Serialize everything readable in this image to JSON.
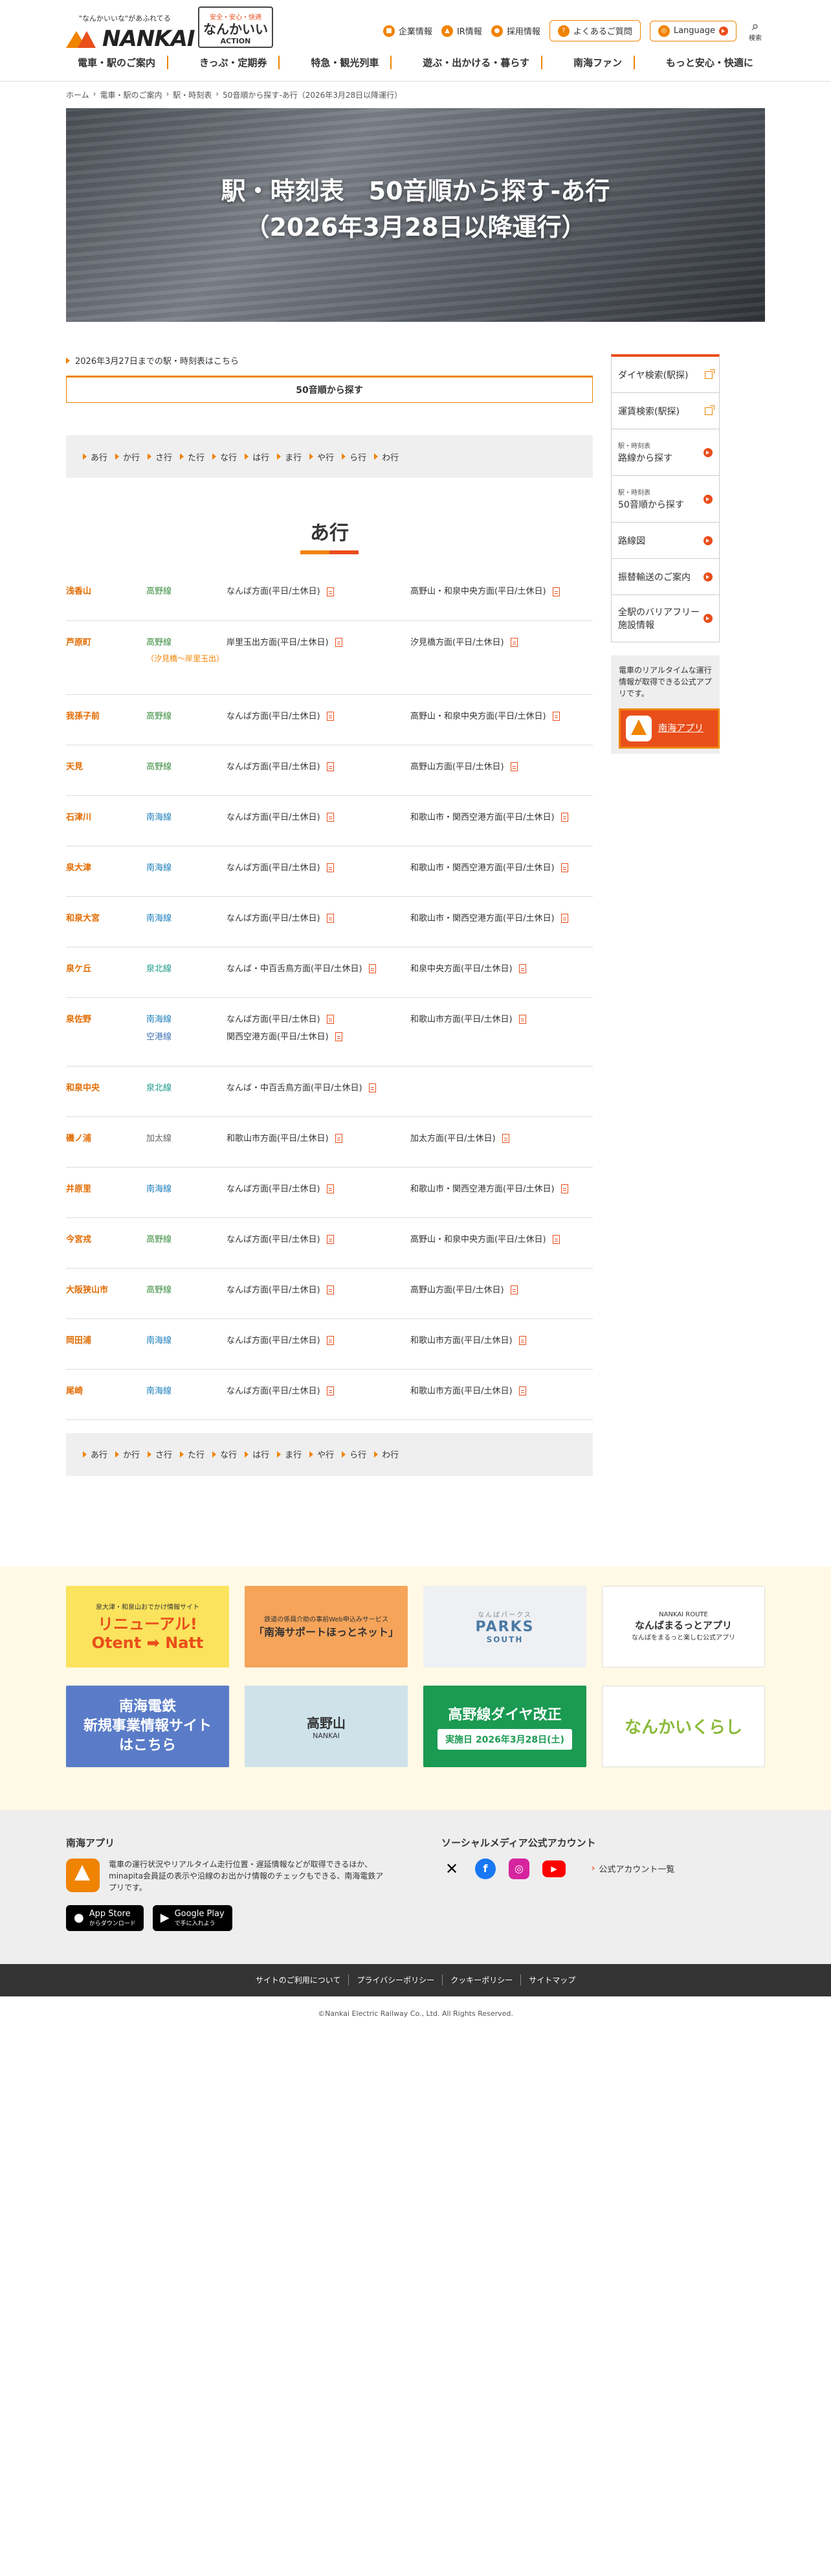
{
  "header": {
    "logo_tagline": "\"なんかいいな\"があふれてる",
    "logo_text": "NANKAI",
    "action_top": "安全・安心・快適",
    "action_main": "なんかいい",
    "action_sub": "ACTION",
    "util": [
      {
        "label": "企業情報",
        "icon": "building-icon"
      },
      {
        "label": "IR情報",
        "icon": "chart-icon"
      },
      {
        "label": "採用情報",
        "icon": "person-icon"
      }
    ],
    "faq_label": "よくあるご質問",
    "language_label": "Language",
    "search_label": "検索"
  },
  "gnav": [
    "電車・駅のご案内",
    "きっぷ・定期券",
    "特急・観光列車",
    "遊ぶ・出かける・暮らす",
    "南海ファン",
    "もっと安心・快適に"
  ],
  "breadcrumb": [
    "ホーム",
    "電車・駅のご案内",
    "駅・時刻表",
    "50音順から探す-あ行（2026年3月28日以降運行）"
  ],
  "hero": {
    "title1": "駅・時刻表　50音順から探す-あ行",
    "title2": "（2026年3月28日以降運行）"
  },
  "prev_link": "2026年3月27日までの駅・時刻表はこちら",
  "tab_label": "50音順から探す",
  "kana": [
    "あ行",
    "か行",
    "さ行",
    "た行",
    "な行",
    "は行",
    "ま行",
    "や行",
    "ら行",
    "わ行"
  ],
  "section_title": "あ行",
  "stations": [
    {
      "name": "浅香山",
      "lines": [
        {
          "label": "高野線",
          "cls": "koya"
        }
      ],
      "tt1": [
        "なんば方面(平日/土休日)"
      ],
      "tt2": [
        "高野山・和泉中央方面(平日/土休日)"
      ]
    },
    {
      "name": "芦原町",
      "lines": [
        {
          "label": "高野線",
          "cls": "koya"
        }
      ],
      "sub": "（汐見橋〜岸里玉出）",
      "tt1": [
        "岸里玉出方面(平日/土休日)"
      ],
      "tt2": [
        "汐見橋方面(平日/土休日)"
      ]
    },
    {
      "name": "我孫子前",
      "lines": [
        {
          "label": "高野線",
          "cls": "koya"
        }
      ],
      "tt1": [
        "なんば方面(平日/土休日)"
      ],
      "tt2": [
        "高野山・和泉中央方面(平日/土休日)"
      ]
    },
    {
      "name": "天見",
      "lines": [
        {
          "label": "高野線",
          "cls": "koya"
        }
      ],
      "tt1": [
        "なんば方面(平日/土休日)"
      ],
      "tt2": [
        "高野山方面(平日/土休日)"
      ]
    },
    {
      "name": "石津川",
      "lines": [
        {
          "label": "南海線",
          "cls": "nankai"
        }
      ],
      "tt1": [
        "なんば方面(平日/土休日)"
      ],
      "tt2": [
        "和歌山市・関西空港方面(平日/土休日)"
      ]
    },
    {
      "name": "泉大津",
      "lines": [
        {
          "label": "南海線",
          "cls": "nankai"
        }
      ],
      "tt1": [
        "なんば方面(平日/土休日)"
      ],
      "tt2": [
        "和歌山市・関西空港方面(平日/土休日)"
      ]
    },
    {
      "name": "和泉大宮",
      "lines": [
        {
          "label": "南海線",
          "cls": "nankai"
        }
      ],
      "tt1": [
        "なんば方面(平日/土休日)"
      ],
      "tt2": [
        "和歌山市・関西空港方面(平日/土休日)"
      ]
    },
    {
      "name": "泉ケ丘",
      "lines": [
        {
          "label": "泉北線",
          "cls": "senboku"
        }
      ],
      "tt1": [
        "なんば・中百舌鳥方面(平日/土休日)"
      ],
      "tt2": [
        "和泉中央方面(平日/土休日)"
      ]
    },
    {
      "name": "泉佐野",
      "lines": [
        {
          "label": "南海線",
          "cls": "nankai"
        },
        {
          "label": "空港線",
          "cls": "airport"
        }
      ],
      "tt1": [
        "なんば方面(平日/土休日)",
        "関西空港方面(平日/土休日)"
      ],
      "tt2": [
        "和歌山市方面(平日/土休日)"
      ]
    },
    {
      "name": "和泉中央",
      "lines": [
        {
          "label": "泉北線",
          "cls": "senboku"
        }
      ],
      "tt1": [
        "なんば・中百舌鳥方面(平日/土休日)"
      ],
      "tt2": []
    },
    {
      "name": "磯ノ浦",
      "lines": [
        {
          "label": "加太線",
          "cls": "kada"
        }
      ],
      "tt1": [
        "和歌山市方面(平日/土休日)"
      ],
      "tt2": [
        "加太方面(平日/土休日)"
      ]
    },
    {
      "name": "井原里",
      "lines": [
        {
          "label": "南海線",
          "cls": "nankai"
        }
      ],
      "tt1": [
        "なんば方面(平日/土休日)"
      ],
      "tt2": [
        "和歌山市・関西空港方面(平日/土休日)"
      ]
    },
    {
      "name": "今宮戎",
      "lines": [
        {
          "label": "高野線",
          "cls": "koya"
        }
      ],
      "tt1": [
        "なんば方面(平日/土休日)"
      ],
      "tt2": [
        "高野山・和泉中央方面(平日/土休日)"
      ]
    },
    {
      "name": "大阪狭山市",
      "lines": [
        {
          "label": "高野線",
          "cls": "koya"
        }
      ],
      "tt1": [
        "なんば方面(平日/土休日)"
      ],
      "tt2": [
        "高野山方面(平日/土休日)"
      ]
    },
    {
      "name": "岡田浦",
      "lines": [
        {
          "label": "南海線",
          "cls": "nankai"
        }
      ],
      "tt1": [
        "なんば方面(平日/土休日)"
      ],
      "tt2": [
        "和歌山市方面(平日/土休日)"
      ]
    },
    {
      "name": "尾崎",
      "lines": [
        {
          "label": "南海線",
          "cls": "nankai"
        }
      ],
      "tt1": [
        "なんば方面(平日/土休日)"
      ],
      "tt2": [
        "和歌山市方面(平日/土休日)"
      ]
    }
  ],
  "side": {
    "items": [
      {
        "small": "",
        "label": "ダイヤ検索(駅探)",
        "icon": "external-link-icon"
      },
      {
        "small": "",
        "label": "運賃検索(駅探)",
        "icon": "external-link-icon"
      },
      {
        "small": "駅・時刻表",
        "label": "路線から探す",
        "icon": "arrow-circle-icon"
      },
      {
        "small": "駅・時刻表",
        "label": "50音順から探す",
        "icon": "arrow-circle-icon"
      },
      {
        "small": "",
        "label": "路線図",
        "icon": "arrow-circle-icon"
      },
      {
        "small": "",
        "label": "振替輸送のご案内",
        "icon": "arrow-circle-icon"
      },
      {
        "small": "",
        "label": "全駅のバリアフリー施設情報",
        "icon": "arrow-circle-icon"
      }
    ],
    "app_text": "電車のリアルタイムな運行情報が取得できる公式アプリです。",
    "app_button": "南海アプリ"
  },
  "banners": [
    {
      "title": "リニューアル!",
      "sub": "泉大津・和泉山おでかけ情報サイト",
      "extra": "Otent ➡ Natt"
    },
    {
      "title": "「南海サポートほっとネット」",
      "sub": "鉄道の係員介助の事前Web申込みサービス",
      "extra": ""
    },
    {
      "title": "PARKS",
      "sub": "なんばパークス",
      "extra": "SOUTH"
    },
    {
      "title": "なんばまるっとアプリ",
      "sub": "NANKAI ROUTE",
      "extra": "なんばをまるっと楽しむ公式アプリ"
    },
    {
      "title": "南海電鉄",
      "sub": "新規事業情報サイト",
      "extra": "はこちら"
    },
    {
      "title": "高野山",
      "sub": "NANKAI",
      "extra": ""
    },
    {
      "title": "高野線ダイヤ改正",
      "sub": "実施日",
      "extra": "2026年3月28日(土)"
    },
    {
      "title": "なんかいくらし",
      "sub": "",
      "extra": ""
    }
  ],
  "footer": {
    "app_heading": "南海アプリ",
    "app_desc": "電車の運行状況やリアルタイム走行位置・遅延情報などが取得できるほか、minapita会員証の表示や沿線のお出かけ情報のチェックもできる、南海電鉄アプリです。",
    "appstore_sub": "App Store",
    "appstore_main": "からダウンロード",
    "googleplay_main": "Google Play",
    "googleplay_sub": "で手に入れよう",
    "sns_heading": "ソーシャルメディア公式アカウント",
    "sns_all": "公式アカウント一覧",
    "links": [
      "サイトのご利用について",
      "プライバシーポリシー",
      "クッキーポリシー",
      "サイトマップ"
    ],
    "copyright": "©Nankai Electric Railway Co., Ltd. All Rights Reserved."
  }
}
